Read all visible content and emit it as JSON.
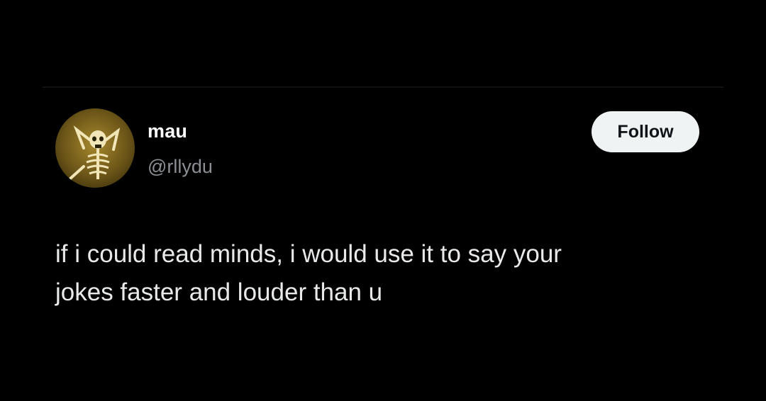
{
  "tweet": {
    "author": {
      "display_name": "mau",
      "handle": "@rllydu",
      "avatar_icon": "skeleton-relaxing-icon"
    },
    "follow_label": "Follow",
    "text_lines": [
      "if i could read minds, i would use it to say your",
      "jokes faster and louder than u"
    ]
  },
  "colors": {
    "background": "#000000",
    "text": "#e7e9ea",
    "handle": "#8b8f94",
    "button_bg": "#eff3f4",
    "button_text": "#0f1419"
  }
}
